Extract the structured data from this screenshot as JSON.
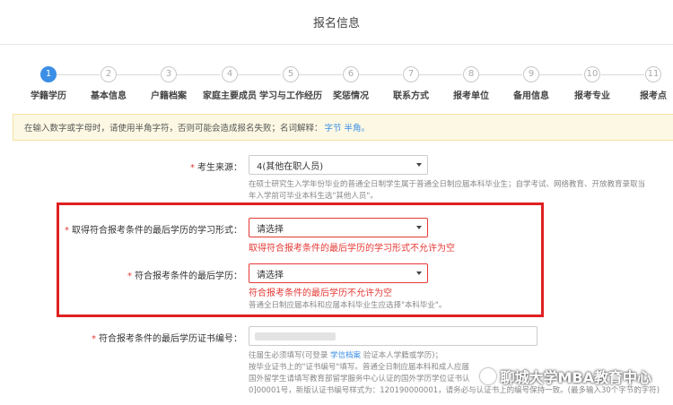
{
  "page_title": "报名信息",
  "steps": [
    {
      "num": "1",
      "label": "学籍学历",
      "active": true
    },
    {
      "num": "2",
      "label": "基本信息",
      "active": false
    },
    {
      "num": "3",
      "label": "户籍档案",
      "active": false
    },
    {
      "num": "4",
      "label": "家庭主要成员",
      "active": false
    },
    {
      "num": "5",
      "label": "学习与工作经历",
      "active": false
    },
    {
      "num": "6",
      "label": "奖惩情况",
      "active": false
    },
    {
      "num": "7",
      "label": "联系方式",
      "active": false
    },
    {
      "num": "8",
      "label": "报考单位",
      "active": false
    },
    {
      "num": "9",
      "label": "备用信息",
      "active": false
    },
    {
      "num": "10",
      "label": "报考专业",
      "active": false
    },
    {
      "num": "11",
      "label": "报考点",
      "active": false
    }
  ],
  "notice": {
    "text": "在输入数字或字母时，请使用半角字符，否则可能会造成报名失败；名词解释：",
    "link": "字节 半角。"
  },
  "form": {
    "source": {
      "label": "考生来源：",
      "value": "4(其他在职人员)",
      "help1": "在硕士研究生入学年份毕业的普通全日制学生属于普通全日制应届本科毕业生；自学考试、网络教育、开放教育录取当",
      "help2": "年入学前可毕业本科生选\"其他人员\"。"
    },
    "study_form": {
      "label": "取得符合报考条件的最后学历的学习形式：",
      "value": "请选择",
      "error": "取得符合报考条件的最后学历的学习形式不允许为空"
    },
    "last_degree": {
      "label": "符合报考条件的最后学历：",
      "value": "请选择",
      "error": "符合报考条件的最后学历不允许为空",
      "help": "普通全日制应届本科和应届本科毕业生应选择\"本科毕业\"。"
    },
    "cert_no": {
      "label": "符合报考条件的最后学历证书编号：",
      "help1": "往届生必须填写(可登录",
      "help1_link": "学信档案",
      "help1_rest": "验证本人学籍或学历)；",
      "help2": "按毕业证书上的\"证书编号\"填写。普通全日制应届本科和成人应届",
      "help3": "国外留学生请填写教育部留学服务中心认证的国外学历学位证书认",
      "help4": "0]00001号，新版认证书编号样式为：120190000001，请务必与认证书上的编号保持一致。(最多输入30个字节的字符)"
    }
  },
  "watermark": "聊城大学MBA教育中心"
}
